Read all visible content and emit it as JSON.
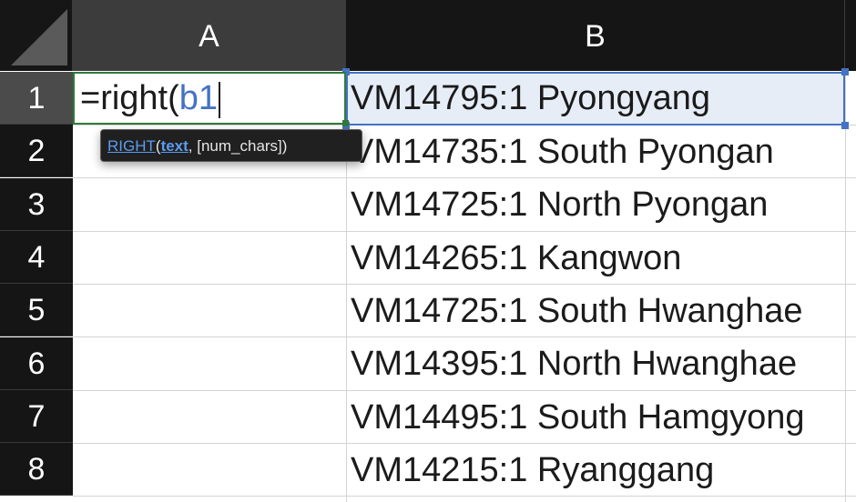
{
  "columns": [
    "A",
    "B"
  ],
  "rows": [
    "1",
    "2",
    "3",
    "4",
    "5",
    "6",
    "7",
    "8"
  ],
  "active_cell": {
    "formula_prefix": "=right(",
    "formula_ref": "b1"
  },
  "tooltip": {
    "function_name": "RIGHT",
    "open_paren": "(",
    "current_arg": "text",
    "rest": ", [num_chars])"
  },
  "column_b_values": [
    "VM14795:1 Pyongyang",
    "VM14735:1 South Pyongan",
    "VM14725:1 North Pyongan",
    "VM14265:1 Kangwon",
    "VM14725:1 South Hwanghae",
    "VM14395:1 North Hwanghae",
    "VM14495:1 South Hamgyong",
    "VM14215:1 Ryanggang"
  ],
  "colors": {
    "active_cell_border": "#2f7a3b",
    "reference_highlight": "#4472c4",
    "header_bg": "#151515"
  }
}
